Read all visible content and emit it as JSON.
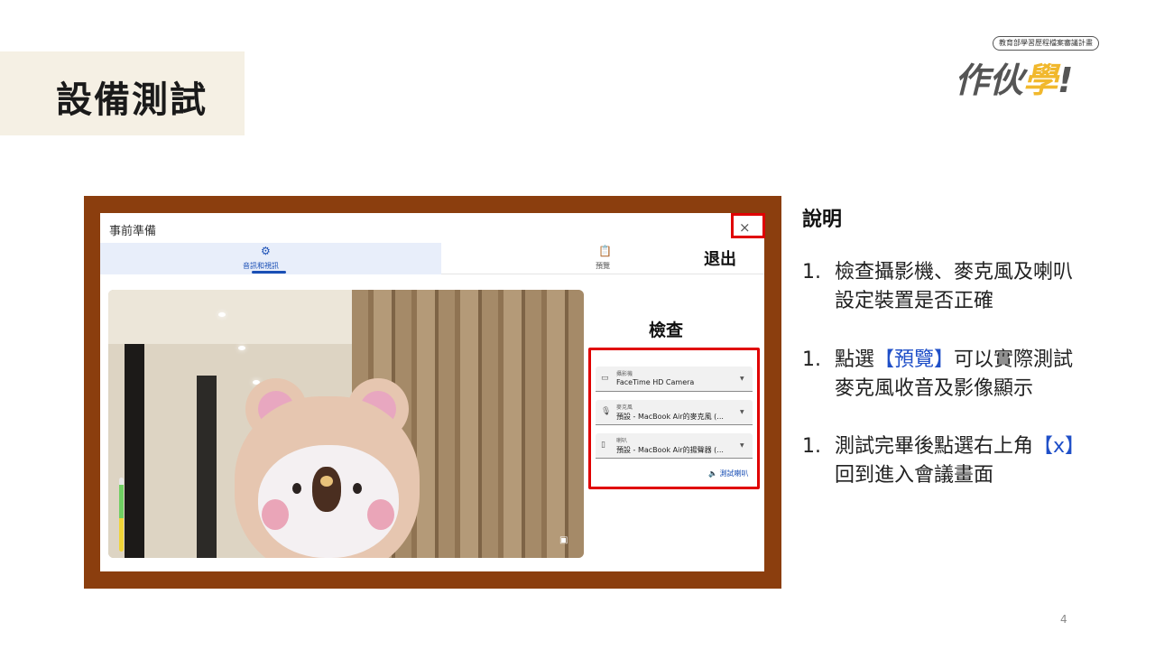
{
  "slide": {
    "title": "設備測試",
    "page_number": "4",
    "logo": {
      "tagline": "教育部學習歷程檔案審議計畫",
      "part1": "作伙",
      "part2": "學",
      "part3": "!"
    }
  },
  "dialog": {
    "title": "事前準備",
    "close_glyph": "×",
    "tabs": [
      {
        "label": "音訊和視訊",
        "icon": "settings-sound-icon"
      },
      {
        "label": "預覽",
        "icon": "clipboard-icon"
      }
    ],
    "exit_label": "退出",
    "check_label": "檢查",
    "devices": [
      {
        "label": "攝影機",
        "value": "FaceTime HD Camera",
        "icon": "camera-icon"
      },
      {
        "label": "麥克風",
        "value": "預設 - MacBook Air的麥克風 (...",
        "icon": "microphone-icon"
      },
      {
        "label": "喇叭",
        "value": "預設 - MacBook Air的揚聲器 (...",
        "icon": "speaker-icon"
      }
    ],
    "test_speaker": "測試喇叭"
  },
  "description": {
    "heading": "說明",
    "items": [
      {
        "num": "1.",
        "lines": [
          "檢查攝影機、麥克風及喇叭",
          "設定裝置是否正確"
        ]
      },
      {
        "num": "1.",
        "line1_pre": "點選",
        "line1_hl": "【預覽】",
        "line1_post": "可以實際測試",
        "line2": "麥克風收音及影像顯示"
      },
      {
        "num": "1.",
        "line1_pre": "測試完畢後點選右上角",
        "line1_hl": "【x】",
        "line2": "回到進入會議畫面"
      }
    ]
  },
  "colors": {
    "frame": "#8b3e0e",
    "highlight_red": "#e00000",
    "accent_blue": "#1f4fc8",
    "title_bg": "#f5f0e4"
  }
}
